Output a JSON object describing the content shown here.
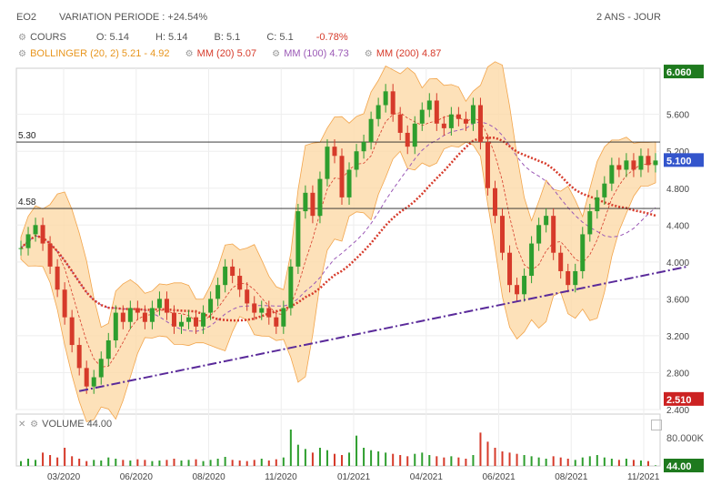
{
  "header": {
    "symbol": "EO2",
    "variation": "VARIATION PERIODE : +24.54%",
    "period": "2 ANS - JOUR"
  },
  "legend": {
    "cours": "COURS",
    "open": "O: 5.14",
    "high": "H: 5.14",
    "low": "B: 5.1",
    "close": "C: 5.1",
    "change": "-0.78%",
    "bollinger": "BOLLINGER (20, 2) 5.21 - 4.92",
    "mm20": "MM (20) 5.07",
    "mm100": "MM (100) 4.73",
    "mm200": "MM (200) 4.87"
  },
  "volume_panel": {
    "label": "VOLUME 44.00",
    "scale_label": "80.000K",
    "last_value": "44.00"
  },
  "colors": {
    "up": "#2e9e2e",
    "down": "#d63a2a",
    "bollinger_fill": "#fcd9a8",
    "bollinger_line": "#f2a44a",
    "mm20": "#d63a2a",
    "mm100": "#9b59b6",
    "mm200": "#d63a2a",
    "trendline": "#5a2a9a",
    "badge_green": "#1e7a1e",
    "badge_blue": "#3355cc",
    "badge_red": "#cc2222"
  },
  "chart_data": {
    "type": "candlestick",
    "title": "",
    "x_ticks": [
      "03/2020",
      "06/2020",
      "08/2020",
      "11/2020",
      "01/2021",
      "04/2021",
      "06/2021",
      "08/2021",
      "11/2021"
    ],
    "y_ticks": [
      "2.400",
      "2.800",
      "3.200",
      "3.600",
      "4.000",
      "4.400",
      "4.800",
      "5.200",
      "5.600"
    ],
    "ylim": [
      2.4,
      6.1
    ],
    "price_badges": {
      "max": "6.060",
      "last": "5.100",
      "min": "2.510"
    },
    "levels": [
      {
        "label": "5.30",
        "value": 5.3
      },
      {
        "label": "4.58",
        "value": 4.58
      }
    ],
    "close_series": [
      4.15,
      4.3,
      4.4,
      4.2,
      3.95,
      3.7,
      3.4,
      3.1,
      2.85,
      2.65,
      2.75,
      2.95,
      3.15,
      3.45,
      3.35,
      3.5,
      3.45,
      3.35,
      3.5,
      3.6,
      3.45,
      3.3,
      3.35,
      3.4,
      3.3,
      3.45,
      3.6,
      3.75,
      3.95,
      3.85,
      3.7,
      3.55,
      3.45,
      3.5,
      3.4,
      3.3,
      3.5,
      3.95,
      4.55,
      4.75,
      4.5,
      4.9,
      5.25,
      5.15,
      4.7,
      5.0,
      5.2,
      5.3,
      5.55,
      5.7,
      5.85,
      5.6,
      5.4,
      5.25,
      5.5,
      5.65,
      5.75,
      5.5,
      5.45,
      5.6,
      5.55,
      5.5,
      5.7,
      5.3,
      4.8,
      4.5,
      4.1,
      3.75,
      3.65,
      3.85,
      4.2,
      4.4,
      4.5,
      4.1,
      3.9,
      3.75,
      3.9,
      4.3,
      4.55,
      4.7,
      4.85,
      5.05,
      5.0,
      5.1,
      5.0,
      5.15,
      5.05,
      5.1
    ],
    "volume_series": [
      8,
      12,
      10,
      22,
      18,
      14,
      30,
      16,
      12,
      8,
      10,
      9,
      14,
      12,
      10,
      9,
      11,
      10,
      8,
      9,
      10,
      12,
      9,
      10,
      11,
      8,
      10,
      12,
      15,
      10,
      9,
      8,
      10,
      12,
      9,
      11,
      14,
      60,
      35,
      28,
      22,
      30,
      26,
      20,
      18,
      22,
      50,
      30,
      26,
      24,
      22,
      20,
      18,
      16,
      20,
      22,
      18,
      16,
      14,
      16,
      14,
      12,
      18,
      55,
      40,
      30,
      24,
      22,
      20,
      18,
      16,
      14,
      12,
      16,
      14,
      12,
      10,
      14,
      16,
      18,
      14,
      12,
      10,
      12,
      10,
      9,
      8,
      1
    ],
    "series": [
      {
        "name": "COURS"
      },
      {
        "name": "BOLLINGER (20, 2)"
      },
      {
        "name": "MM (20)"
      },
      {
        "name": "MM (100)"
      },
      {
        "name": "MM (200)"
      }
    ]
  }
}
